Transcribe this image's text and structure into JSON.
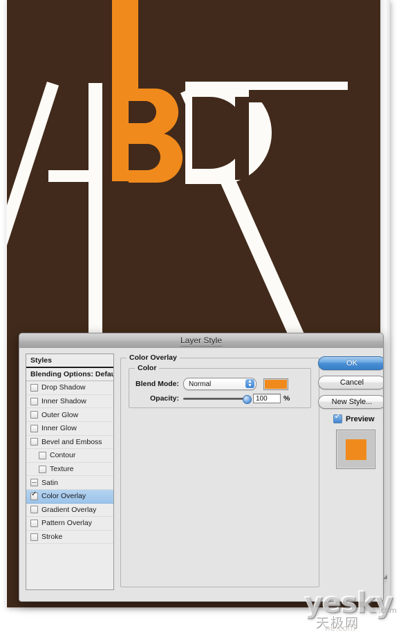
{
  "app": {
    "document_canvas_color": "#412a1b",
    "artwork_letters": "ABD7",
    "artwork_orange": "#f08a1c",
    "artwork_white": "#fdfbf7",
    "resize_grip_icon": "resize-grip-icon"
  },
  "dialog": {
    "title": "Layer Style",
    "styles_list": [
      {
        "label": "Styles",
        "type": "header",
        "checkbox": "none",
        "indent": false,
        "selected": false
      },
      {
        "label": "Blending Options: Default",
        "type": "header",
        "checkbox": "none",
        "indent": false,
        "selected": false
      },
      {
        "label": "Drop Shadow",
        "type": "effect",
        "checkbox": "unchecked",
        "indent": false,
        "selected": false
      },
      {
        "label": "Inner Shadow",
        "type": "effect",
        "checkbox": "unchecked",
        "indent": false,
        "selected": false
      },
      {
        "label": "Outer Glow",
        "type": "effect",
        "checkbox": "unchecked",
        "indent": false,
        "selected": false
      },
      {
        "label": "Inner Glow",
        "type": "effect",
        "checkbox": "unchecked",
        "indent": false,
        "selected": false
      },
      {
        "label": "Bevel and Emboss",
        "type": "effect",
        "checkbox": "unchecked",
        "indent": false,
        "selected": false
      },
      {
        "label": "Contour",
        "type": "effect",
        "checkbox": "unchecked",
        "indent": true,
        "selected": false
      },
      {
        "label": "Texture",
        "type": "effect",
        "checkbox": "unchecked",
        "indent": true,
        "selected": false
      },
      {
        "label": "Satin",
        "type": "effect",
        "checkbox": "dash",
        "indent": false,
        "selected": false
      },
      {
        "label": "Color Overlay",
        "type": "effect",
        "checkbox": "checked",
        "indent": false,
        "selected": true
      },
      {
        "label": "Gradient Overlay",
        "type": "effect",
        "checkbox": "unchecked",
        "indent": false,
        "selected": false
      },
      {
        "label": "Pattern Overlay",
        "type": "effect",
        "checkbox": "unchecked",
        "indent": false,
        "selected": false
      },
      {
        "label": "Stroke",
        "type": "effect",
        "checkbox": "unchecked",
        "indent": false,
        "selected": false
      }
    ],
    "panel": {
      "legend": "Color Overlay",
      "color_group_legend": "Color",
      "blend_mode_label": "Blend Mode:",
      "blend_mode_value": "Normal",
      "blend_mode_arrows_icon": "stepper-arrows-icon",
      "color_swatch_hex": "#f08a1c",
      "opacity_label": "Opacity:",
      "opacity_value": "100",
      "opacity_unit": "%",
      "opacity_percent_fill": 90
    },
    "buttons": {
      "ok": "OK",
      "cancel": "Cancel",
      "new_style": "New Style...",
      "ok_accent_hex": "#4b8fd4"
    },
    "preview": {
      "label": "Preview",
      "checked": true,
      "thumbnail_color": "#f08a1c",
      "thumbnail_bg": "#c6c6c6"
    }
  },
  "watermark": {
    "main": "yesky",
    "com": ".com",
    "chinese": "天极网",
    "sub": "ne.com"
  }
}
